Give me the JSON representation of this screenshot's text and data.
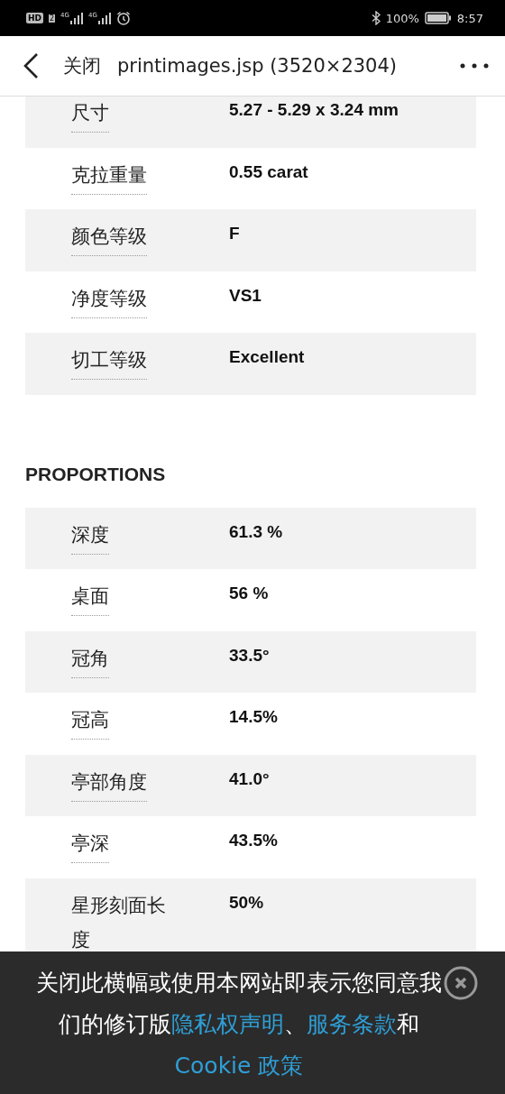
{
  "status_bar": {
    "hd": "HD",
    "sim": "2",
    "networks": [
      "4G",
      "4G"
    ],
    "battery_percent": "100%",
    "time": "8:57"
  },
  "header": {
    "close": "关闭",
    "title": "printimages.jsp (3520×2304)"
  },
  "details": [
    {
      "label": "尺寸",
      "value": "5.27 - 5.29 x 3.24 mm"
    },
    {
      "label": "克拉重量",
      "value": "0.55 carat"
    },
    {
      "label": "颜色等级",
      "value": "F"
    },
    {
      "label": "净度等级",
      "value": "VS1"
    },
    {
      "label": "切工等级",
      "value": "Excellent"
    }
  ],
  "proportions": {
    "title": "PROPORTIONS",
    "rows": [
      {
        "label": "深度",
        "value": "61.3 %"
      },
      {
        "label": "桌面",
        "value": "56 %"
      },
      {
        "label": "冠角",
        "value": "33.5°"
      },
      {
        "label": "冠高",
        "value": "14.5%"
      },
      {
        "label": "亭部角度",
        "value": "41.0°"
      },
      {
        "label": "亭深",
        "value": "43.5%"
      },
      {
        "label": "星形刻面长度",
        "value": "50%"
      }
    ]
  },
  "cookie_banner": {
    "segments": [
      {
        "kind": "plain",
        "text": "关闭此横幅或使用本网站即表示您同意我们的修订版"
      },
      {
        "kind": "link",
        "text": "隐私权声明"
      },
      {
        "kind": "plain",
        "text": "、"
      },
      {
        "kind": "link",
        "text": "服务条款"
      },
      {
        "kind": "plain",
        "text": "和 "
      },
      {
        "kind": "link",
        "text": "Cookie 政策"
      }
    ]
  }
}
